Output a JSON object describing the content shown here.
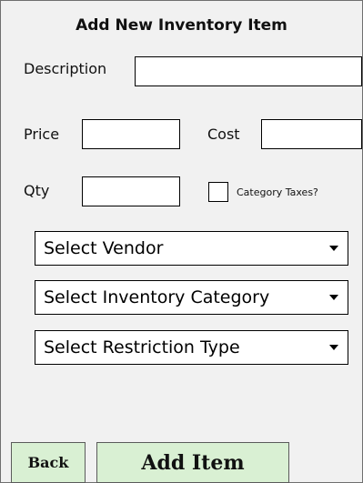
{
  "form": {
    "title": "Add New Inventory Item",
    "description_label": "Description",
    "description_value": "",
    "price_label": "Price",
    "price_value": "",
    "cost_label": "Cost",
    "cost_value": "",
    "qty_label": "Qty",
    "qty_value": "",
    "category_taxes_label": "Category Taxes?",
    "category_taxes_checked": false,
    "vendor_select": "Select Vendor",
    "category_select": "Select Inventory Category",
    "restriction_select": "Select Restriction Type"
  },
  "actions": {
    "back_label": "Back",
    "add_item_label": "Add Item"
  },
  "colors": {
    "background": "#f1f1f1",
    "button_fill": "#d9f0d3",
    "field_fill": "#ffffff"
  }
}
